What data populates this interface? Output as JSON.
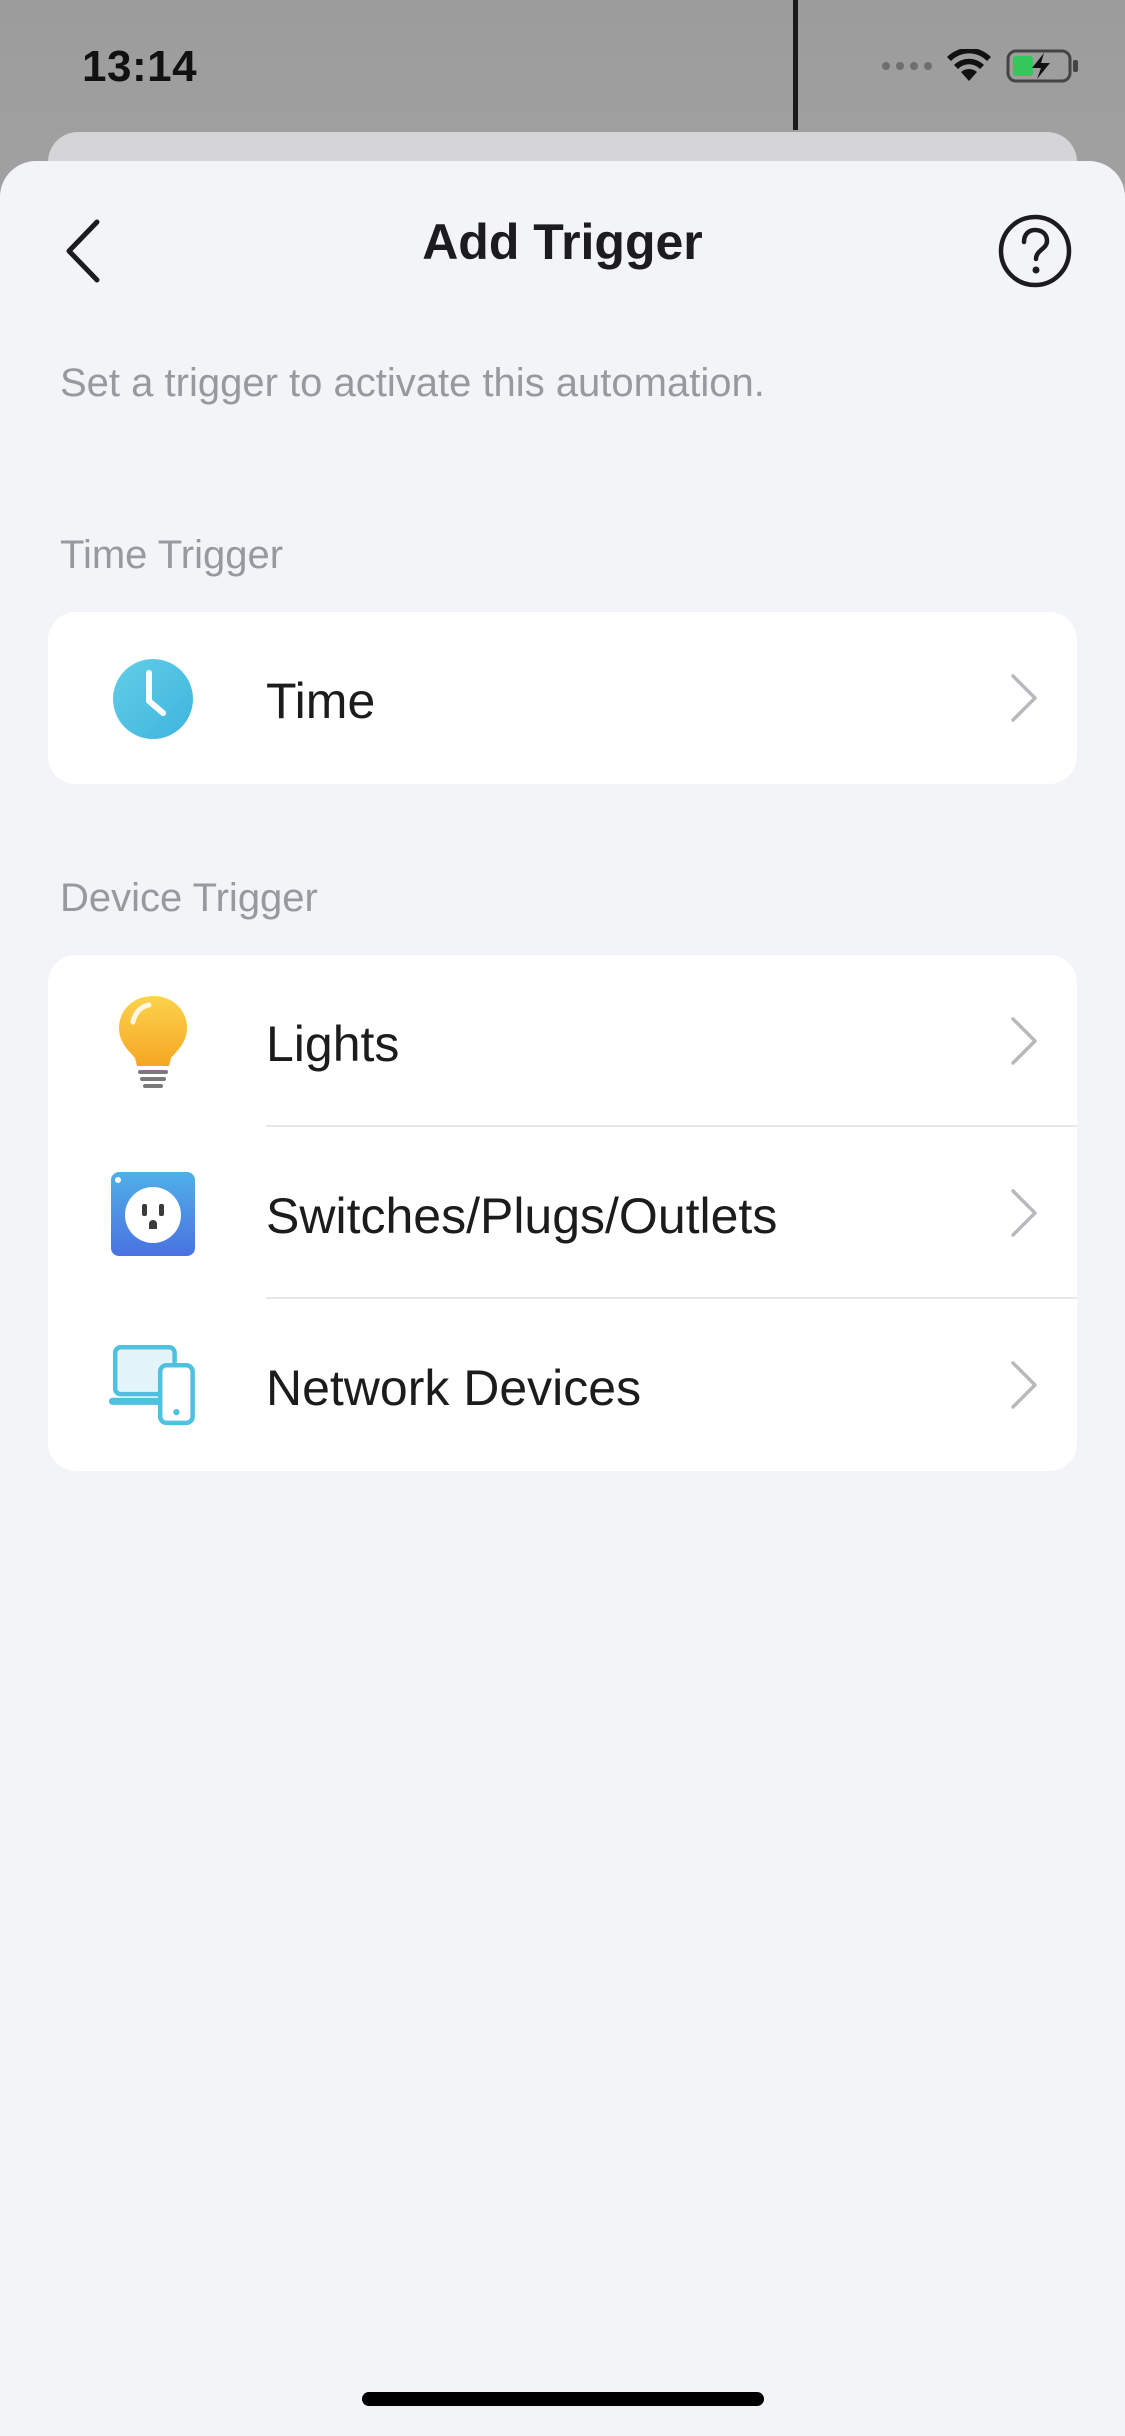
{
  "status_bar": {
    "time": "13:14"
  },
  "nav": {
    "title": "Add Trigger",
    "back_icon": "chevron-left-icon",
    "help_icon": "question-circle-icon"
  },
  "subtitle": "Set a trigger to activate this automation.",
  "sections": [
    {
      "label": "Time Trigger",
      "items": [
        {
          "label": "Time",
          "icon": "clock-icon"
        }
      ]
    },
    {
      "label": "Device Trigger",
      "items": [
        {
          "label": "Lights",
          "icon": "light-bulb-icon"
        },
        {
          "label": "Switches/Plugs/Outlets",
          "icon": "outlet-icon"
        },
        {
          "label": "Network Devices",
          "icon": "network-devices-icon"
        }
      ]
    }
  ],
  "colors": {
    "sheet_background": "#f3f4f8",
    "card_background": "#ffffff",
    "secondary_text": "#98999e",
    "clock_blue": "#4fc0e0",
    "bulb_yellow": "#f7b733",
    "outlet_blue": "#4a7fe0"
  }
}
